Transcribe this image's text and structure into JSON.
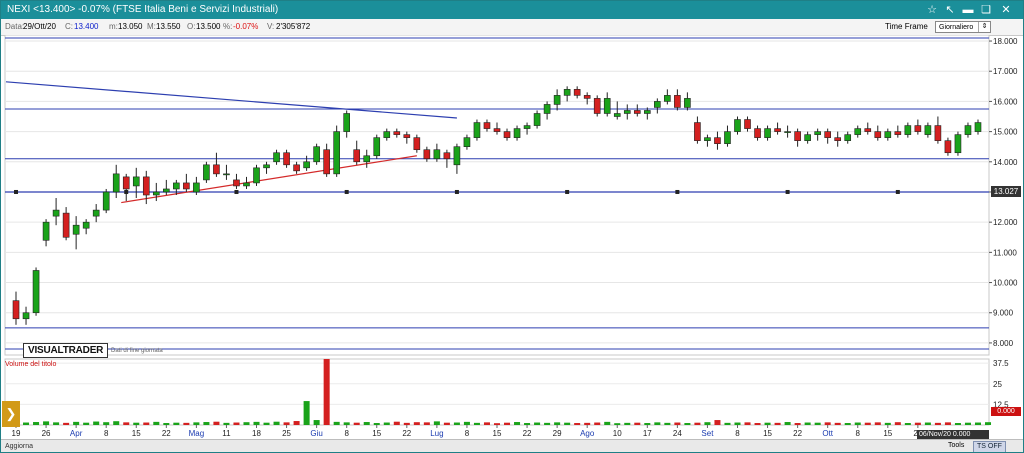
{
  "window": {
    "title": "NEXI <13.400> -0.07%  (FTSE Italia Beni e Servizi Industriali)"
  },
  "infobar": {
    "data_label": "Data:",
    "data_value": "29/Ott/20",
    "c_label": "C:",
    "c_value": "13.400",
    "m_label": "m:",
    "m_value": "13.050",
    "M_label": "M:",
    "M_value": "13.550",
    "o_label": "O:",
    "o_value": "13.500",
    "pct_label": "%:",
    "pct_value": "-0.07%",
    "v_label": "V:",
    "v_value": "2'305'872",
    "timeframe_label": "Time Frame",
    "timeframe_value": "Giornaliero"
  },
  "overlay": {
    "logo": "VISUALTRADER",
    "logo_sub": "Dati di fine giornata",
    "volume_label": "Volume del titolo",
    "price_tag": "13.027",
    "date_box": "06/Nov/20 0.000",
    "red_box": "0.000"
  },
  "bottombar": {
    "aggiorna": "Aggiorna",
    "tools": "Tools",
    "tsoff": "TS OFF"
  },
  "colors": {
    "up": "#1aa31a",
    "down": "#d42020",
    "hline": "#2d3fb0",
    "trend_blue": "#2d3fb0",
    "trend_red": "#d42a2a",
    "titlebar": "#1b8f9a"
  },
  "chart_data": {
    "type": "candlestick",
    "price_ticks": [
      "18.000",
      "17.000",
      "16.000",
      "15.000",
      "14.000",
      "13.000",
      "12.000",
      "11.000",
      "10.000",
      "9.000",
      "8.000"
    ],
    "volume_ticks": [
      "37.5",
      "25",
      "12.5"
    ],
    "volume_ylim": [
      0,
      40
    ],
    "ylim": [
      7.6,
      18.2
    ],
    "x_labels": [
      "19",
      "26",
      "Apr",
      "8",
      "15",
      "22",
      "Mag",
      "11",
      "18",
      "25",
      "Giu",
      "8",
      "15",
      "22",
      "Lug",
      "8",
      "15",
      "22",
      "29",
      "Ago",
      "10",
      "17",
      "24",
      "Set",
      "8",
      "15",
      "22",
      "Ott",
      "8",
      "15",
      "22"
    ],
    "x_label_positions": [
      0,
      3,
      6,
      9,
      12,
      15,
      18,
      21,
      24,
      27,
      30,
      33,
      36,
      39,
      42,
      45,
      48,
      51,
      54,
      57,
      60,
      63,
      66,
      69,
      72,
      75,
      78,
      81,
      84,
      87,
      90
    ],
    "x_label_colored": [
      "Apr",
      "Mag",
      "Giu",
      "Lug",
      "Ago",
      "Set",
      "Ott"
    ],
    "horizontal_lines": [
      18.1,
      15.75,
      14.1,
      13.0,
      8.5,
      7.8
    ],
    "support_line": 13.0,
    "trend_lines": [
      {
        "name": "resistance",
        "x1": -1,
        "y1": 16.65,
        "x2": 44,
        "y2": 15.45
      },
      {
        "name": "support",
        "x1": 10.5,
        "y1": 12.65,
        "x2": 40,
        "y2": 14.2
      }
    ],
    "candles": [
      {
        "o": 9.4,
        "h": 9.7,
        "l": 8.6,
        "c": 8.8
      },
      {
        "o": 8.8,
        "h": 9.2,
        "l": 8.6,
        "c": 9.0
      },
      {
        "o": 9.0,
        "h": 10.5,
        "l": 8.9,
        "c": 10.4
      },
      {
        "o": 11.4,
        "h": 12.1,
        "l": 11.2,
        "c": 12.0
      },
      {
        "o": 12.2,
        "h": 12.8,
        "l": 11.9,
        "c": 12.4
      },
      {
        "o": 12.3,
        "h": 12.5,
        "l": 11.4,
        "c": 11.5
      },
      {
        "o": 11.6,
        "h": 12.2,
        "l": 11.1,
        "c": 11.9
      },
      {
        "o": 11.8,
        "h": 12.1,
        "l": 11.6,
        "c": 12.0
      },
      {
        "o": 12.2,
        "h": 12.6,
        "l": 12.0,
        "c": 12.4
      },
      {
        "o": 12.4,
        "h": 13.1,
        "l": 12.3,
        "c": 13.0
      },
      {
        "o": 13.0,
        "h": 13.9,
        "l": 12.8,
        "c": 13.6
      },
      {
        "o": 13.5,
        "h": 13.6,
        "l": 12.7,
        "c": 13.1
      },
      {
        "o": 13.2,
        "h": 13.8,
        "l": 12.8,
        "c": 13.5
      },
      {
        "o": 13.5,
        "h": 13.7,
        "l": 12.6,
        "c": 12.9
      },
      {
        "o": 12.9,
        "h": 13.3,
        "l": 12.7,
        "c": 13.0
      },
      {
        "o": 13.0,
        "h": 13.4,
        "l": 12.9,
        "c": 13.1
      },
      {
        "o": 13.1,
        "h": 13.4,
        "l": 12.9,
        "c": 13.3
      },
      {
        "o": 13.3,
        "h": 13.6,
        "l": 13.0,
        "c": 13.1
      },
      {
        "o": 13.0,
        "h": 13.5,
        "l": 12.9,
        "c": 13.3
      },
      {
        "o": 13.4,
        "h": 14.0,
        "l": 13.3,
        "c": 13.9
      },
      {
        "o": 13.9,
        "h": 14.3,
        "l": 13.5,
        "c": 13.6
      },
      {
        "o": 13.6,
        "h": 13.9,
        "l": 13.4,
        "c": 13.6
      },
      {
        "o": 13.4,
        "h": 13.6,
        "l": 13.1,
        "c": 13.2
      },
      {
        "o": 13.2,
        "h": 13.5,
        "l": 13.1,
        "c": 13.3
      },
      {
        "o": 13.3,
        "h": 13.9,
        "l": 13.2,
        "c": 13.8
      },
      {
        "o": 13.8,
        "h": 14.0,
        "l": 13.6,
        "c": 13.9
      },
      {
        "o": 14.0,
        "h": 14.4,
        "l": 13.9,
        "c": 14.3
      },
      {
        "o": 14.3,
        "h": 14.4,
        "l": 13.8,
        "c": 13.9
      },
      {
        "o": 13.9,
        "h": 14.0,
        "l": 13.6,
        "c": 13.7
      },
      {
        "o": 13.8,
        "h": 14.2,
        "l": 13.7,
        "c": 14.0
      },
      {
        "o": 14.0,
        "h": 14.6,
        "l": 13.9,
        "c": 14.5
      },
      {
        "o": 14.4,
        "h": 14.6,
        "l": 13.5,
        "c": 13.6
      },
      {
        "o": 13.6,
        "h": 15.2,
        "l": 13.5,
        "c": 15.0
      },
      {
        "o": 15.0,
        "h": 15.7,
        "l": 14.8,
        "c": 15.6
      },
      {
        "o": 14.4,
        "h": 14.7,
        "l": 13.9,
        "c": 14.0
      },
      {
        "o": 14.0,
        "h": 14.4,
        "l": 13.8,
        "c": 14.2
      },
      {
        "o": 14.2,
        "h": 14.9,
        "l": 14.1,
        "c": 14.8
      },
      {
        "o": 14.8,
        "h": 15.1,
        "l": 14.7,
        "c": 15.0
      },
      {
        "o": 15.0,
        "h": 15.1,
        "l": 14.8,
        "c": 14.9
      },
      {
        "o": 14.9,
        "h": 15.0,
        "l": 14.6,
        "c": 14.8
      },
      {
        "o": 14.8,
        "h": 14.9,
        "l": 14.3,
        "c": 14.4
      },
      {
        "o": 14.4,
        "h": 14.5,
        "l": 14.0,
        "c": 14.1
      },
      {
        "o": 14.1,
        "h": 14.6,
        "l": 14.0,
        "c": 14.4
      },
      {
        "o": 14.3,
        "h": 14.4,
        "l": 13.8,
        "c": 14.1
      },
      {
        "o": 13.9,
        "h": 14.6,
        "l": 13.6,
        "c": 14.5
      },
      {
        "o": 14.5,
        "h": 14.9,
        "l": 14.4,
        "c": 14.8
      },
      {
        "o": 14.8,
        "h": 15.4,
        "l": 14.7,
        "c": 15.3
      },
      {
        "o": 15.3,
        "h": 15.4,
        "l": 15.0,
        "c": 15.1
      },
      {
        "o": 15.1,
        "h": 15.3,
        "l": 14.9,
        "c": 15.0
      },
      {
        "o": 15.0,
        "h": 15.1,
        "l": 14.7,
        "c": 14.8
      },
      {
        "o": 14.8,
        "h": 15.2,
        "l": 14.7,
        "c": 15.1
      },
      {
        "o": 15.1,
        "h": 15.3,
        "l": 14.9,
        "c": 15.2
      },
      {
        "o": 15.2,
        "h": 15.7,
        "l": 15.1,
        "c": 15.6
      },
      {
        "o": 15.6,
        "h": 16.0,
        "l": 15.4,
        "c": 15.9
      },
      {
        "o": 15.9,
        "h": 16.4,
        "l": 15.7,
        "c": 16.2
      },
      {
        "o": 16.2,
        "h": 16.5,
        "l": 16.0,
        "c": 16.4
      },
      {
        "o": 16.4,
        "h": 16.5,
        "l": 16.1,
        "c": 16.2
      },
      {
        "o": 16.2,
        "h": 16.3,
        "l": 15.9,
        "c": 16.1
      },
      {
        "o": 16.1,
        "h": 16.2,
        "l": 15.5,
        "c": 15.6
      },
      {
        "o": 15.6,
        "h": 16.3,
        "l": 15.5,
        "c": 16.1
      },
      {
        "o": 15.5,
        "h": 16.0,
        "l": 15.4,
        "c": 15.6
      },
      {
        "o": 15.6,
        "h": 15.9,
        "l": 15.4,
        "c": 15.7
      },
      {
        "o": 15.7,
        "h": 15.9,
        "l": 15.5,
        "c": 15.6
      },
      {
        "o": 15.6,
        "h": 15.8,
        "l": 15.4,
        "c": 15.7
      },
      {
        "o": 15.8,
        "h": 16.1,
        "l": 15.6,
        "c": 16.0
      },
      {
        "o": 16.0,
        "h": 16.4,
        "l": 15.9,
        "c": 16.2
      },
      {
        "o": 16.2,
        "h": 16.4,
        "l": 15.7,
        "c": 15.8
      },
      {
        "o": 15.8,
        "h": 16.3,
        "l": 15.7,
        "c": 16.1
      },
      {
        "o": 15.3,
        "h": 15.5,
        "l": 14.6,
        "c": 14.7
      },
      {
        "o": 14.7,
        "h": 14.9,
        "l": 14.5,
        "c": 14.8
      },
      {
        "o": 14.8,
        "h": 15.0,
        "l": 14.4,
        "c": 14.6
      },
      {
        "o": 14.6,
        "h": 15.2,
        "l": 14.5,
        "c": 15.0
      },
      {
        "o": 15.0,
        "h": 15.5,
        "l": 14.9,
        "c": 15.4
      },
      {
        "o": 15.4,
        "h": 15.5,
        "l": 15.0,
        "c": 15.1
      },
      {
        "o": 15.1,
        "h": 15.2,
        "l": 14.7,
        "c": 14.8
      },
      {
        "o": 14.8,
        "h": 15.2,
        "l": 14.7,
        "c": 15.1
      },
      {
        "o": 15.1,
        "h": 15.3,
        "l": 14.9,
        "c": 15.0
      },
      {
        "o": 15.0,
        "h": 15.2,
        "l": 14.8,
        "c": 15.0
      },
      {
        "o": 15.0,
        "h": 15.1,
        "l": 14.5,
        "c": 14.7
      },
      {
        "o": 14.7,
        "h": 15.0,
        "l": 14.6,
        "c": 14.9
      },
      {
        "o": 14.9,
        "h": 15.1,
        "l": 14.7,
        "c": 15.0
      },
      {
        "o": 15.0,
        "h": 15.1,
        "l": 14.6,
        "c": 14.8
      },
      {
        "o": 14.8,
        "h": 15.0,
        "l": 14.5,
        "c": 14.7
      },
      {
        "o": 14.7,
        "h": 15.0,
        "l": 14.6,
        "c": 14.9
      },
      {
        "o": 14.9,
        "h": 15.2,
        "l": 14.8,
        "c": 15.1
      },
      {
        "o": 15.1,
        "h": 15.3,
        "l": 14.9,
        "c": 15.0
      },
      {
        "o": 15.0,
        "h": 15.2,
        "l": 14.7,
        "c": 14.8
      },
      {
        "o": 14.8,
        "h": 15.1,
        "l": 14.7,
        "c": 15.0
      },
      {
        "o": 15.0,
        "h": 15.2,
        "l": 14.8,
        "c": 14.9
      },
      {
        "o": 14.9,
        "h": 15.3,
        "l": 14.8,
        "c": 15.2
      },
      {
        "o": 15.2,
        "h": 15.4,
        "l": 14.9,
        "c": 15.0
      },
      {
        "o": 14.9,
        "h": 15.3,
        "l": 14.8,
        "c": 15.2
      },
      {
        "o": 15.2,
        "h": 15.5,
        "l": 14.6,
        "c": 14.7
      },
      {
        "o": 14.7,
        "h": 14.8,
        "l": 14.2,
        "c": 14.3
      },
      {
        "o": 14.3,
        "h": 15.0,
        "l": 14.2,
        "c": 14.9
      },
      {
        "o": 14.9,
        "h": 15.3,
        "l": 14.8,
        "c": 15.2
      },
      {
        "o": 15.0,
        "h": 15.4,
        "l": 14.9,
        "c": 15.3
      }
    ],
    "volumes": [
      2.5,
      1.5,
      1.8,
      2.2,
      1.6,
      1.3,
      1.9,
      1.4,
      2.1,
      1.7,
      2.3,
      1.6,
      1.4,
      1.5,
      1.9,
      1.2,
      1.4,
      1.3,
      1.6,
      1.8,
      2.0,
      1.3,
      1.5,
      1.7,
      1.9,
      1.4,
      2.0,
      1.6,
      2.4,
      14.5,
      3.0,
      40.0,
      1.9,
      1.6,
      1.4,
      1.8,
      1.2,
      1.5,
      2.0,
      1.3,
      1.7,
      1.6,
      2.2,
      1.4,
      1.5,
      1.9,
      1.3,
      1.6,
      1.1,
      1.4,
      1.8,
      1.2,
      1.5,
      1.3,
      1.6,
      1.4,
      1.2,
      1.3,
      1.5,
      1.9,
      1.1,
      1.3,
      1.4,
      1.2,
      1.6,
      1.3,
      1.5,
      1.2,
      1.4,
      1.7,
      3.0,
      1.3,
      1.5,
      1.6,
      1.2,
      1.4,
      1.3,
      1.8,
      1.2,
      1.5,
      1.4,
      1.6,
      1.3,
      1.2,
      1.5,
      1.4,
      1.6,
      1.3,
      1.7,
      1.2,
      1.4,
      1.5,
      1.3,
      1.6,
      1.2,
      1.4,
      1.5,
      1.7
    ]
  }
}
